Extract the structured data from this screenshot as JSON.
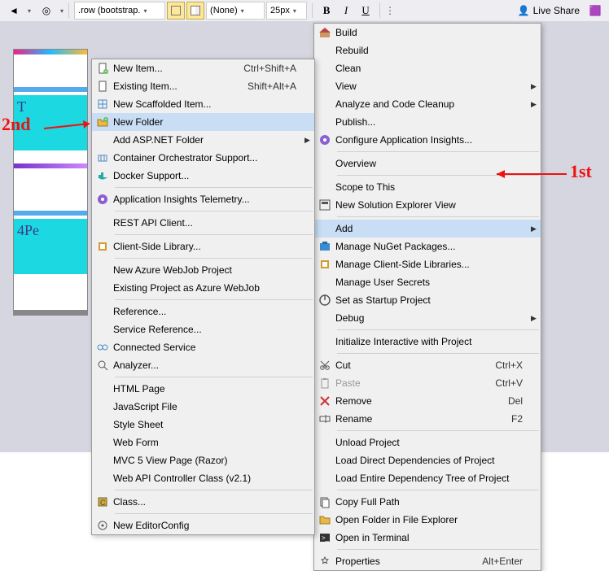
{
  "toolbar": {
    "selector": ".row (bootstrap.",
    "style_sel": "(None)",
    "size": "25px",
    "bold": "B",
    "italic": "I",
    "underline": "U",
    "liveshare": "Live Share"
  },
  "doc": {
    "t_label": "T",
    "pe_label": "4Pe"
  },
  "menu1": {
    "items": [
      {
        "label": "Build",
        "icon": "build"
      },
      {
        "label": "Rebuild"
      },
      {
        "label": "Clean"
      },
      {
        "label": "View",
        "sub": true
      },
      {
        "label": "Analyze and Code Cleanup",
        "sub": true
      },
      {
        "label": "Publish..."
      },
      {
        "label": "Configure Application Insights...",
        "icon": "appinsights"
      },
      {
        "sep": true
      },
      {
        "label": "Overview"
      },
      {
        "sep": true
      },
      {
        "label": "Scope to This"
      },
      {
        "label": "New Solution Explorer View",
        "icon": "solution"
      },
      {
        "sep": true
      },
      {
        "label": "Add",
        "sub": true,
        "hl": true
      },
      {
        "label": "Manage NuGet Packages...",
        "icon": "nuget"
      },
      {
        "label": "Manage Client-Side Libraries...",
        "icon": "clientlib"
      },
      {
        "label": "Manage User Secrets"
      },
      {
        "label": "Set as Startup Project",
        "icon": "startup"
      },
      {
        "label": "Debug",
        "sub": true
      },
      {
        "sep": true
      },
      {
        "label": "Initialize Interactive with Project"
      },
      {
        "sep": true
      },
      {
        "label": "Cut",
        "icon": "cut",
        "short": "Ctrl+X"
      },
      {
        "label": "Paste",
        "icon": "paste",
        "short": "Ctrl+V",
        "disabled": true
      },
      {
        "label": "Remove",
        "icon": "remove",
        "short": "Del"
      },
      {
        "label": "Rename",
        "icon": "rename",
        "short": "F2"
      },
      {
        "sep": true
      },
      {
        "label": "Unload Project"
      },
      {
        "label": "Load Direct Dependencies of Project"
      },
      {
        "label": "Load Entire Dependency Tree of Project"
      },
      {
        "sep": true
      },
      {
        "label": "Copy Full Path",
        "icon": "copy"
      },
      {
        "label": "Open Folder in File Explorer",
        "icon": "openfolder"
      },
      {
        "label": "Open in Terminal",
        "icon": "terminal"
      },
      {
        "sep": true
      },
      {
        "label": "Properties",
        "icon": "props",
        "short": "Alt+Enter"
      }
    ]
  },
  "menu2": {
    "items": [
      {
        "label": "New Item...",
        "icon": "newitem",
        "short": "Ctrl+Shift+A"
      },
      {
        "label": "Existing Item...",
        "icon": "existitem",
        "short": "Shift+Alt+A"
      },
      {
        "label": "New Scaffolded Item...",
        "icon": "scaffold"
      },
      {
        "label": "New Folder",
        "icon": "newfolder",
        "hl": true
      },
      {
        "label": "Add ASP.NET Folder",
        "sub": true
      },
      {
        "label": "Container Orchestrator Support...",
        "icon": "container"
      },
      {
        "label": "Docker Support...",
        "icon": "docker"
      },
      {
        "sep": true
      },
      {
        "label": "Application Insights Telemetry...",
        "icon": "appinsights"
      },
      {
        "sep": true
      },
      {
        "label": "REST API Client..."
      },
      {
        "sep": true
      },
      {
        "label": "Client-Side Library...",
        "icon": "clientlib"
      },
      {
        "sep": true
      },
      {
        "label": "New Azure WebJob Project"
      },
      {
        "label": "Existing Project as Azure WebJob"
      },
      {
        "sep": true
      },
      {
        "label": "Reference..."
      },
      {
        "label": "Service Reference..."
      },
      {
        "label": "Connected Service",
        "icon": "connected"
      },
      {
        "label": "Analyzer...",
        "icon": "analyzer"
      },
      {
        "sep": true
      },
      {
        "label": "HTML Page"
      },
      {
        "label": "JavaScript File"
      },
      {
        "label": "Style Sheet"
      },
      {
        "label": "Web Form"
      },
      {
        "label": "MVC 5 View Page (Razor)"
      },
      {
        "label": "Web API Controller Class (v2.1)"
      },
      {
        "sep": true
      },
      {
        "label": "Class...",
        "icon": "class"
      },
      {
        "sep": true
      },
      {
        "label": "New EditorConfig",
        "icon": "editorconfig"
      }
    ]
  },
  "annotations": {
    "first": "1st",
    "second": "2nd"
  }
}
